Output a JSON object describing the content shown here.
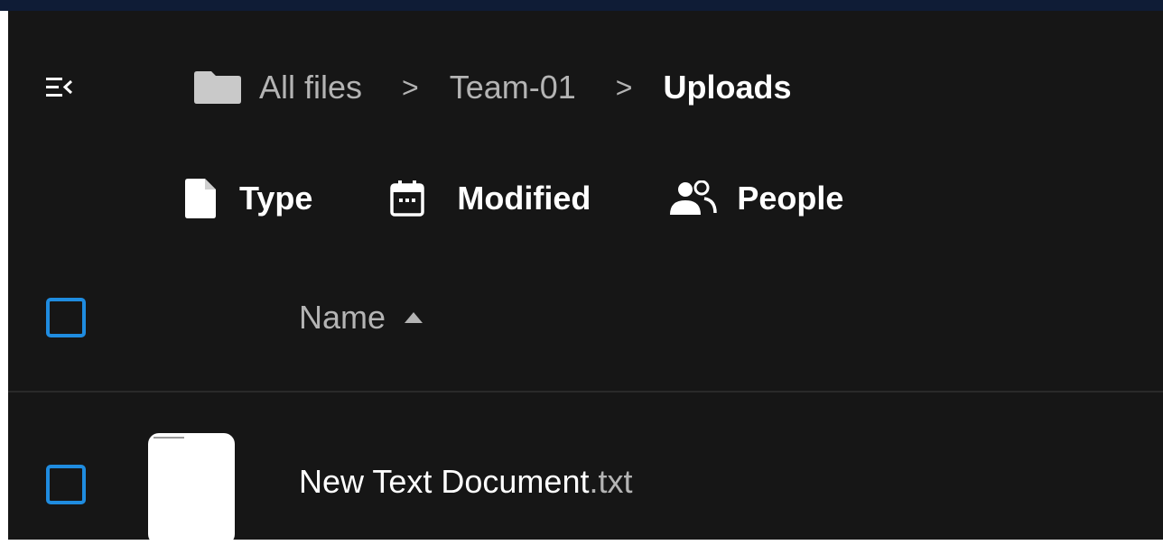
{
  "breadcrumb": {
    "root": "All files",
    "items": [
      "Team-01"
    ],
    "current": "Uploads",
    "separator": ">"
  },
  "filters": {
    "type": "Type",
    "modified": "Modified",
    "people": "People"
  },
  "table": {
    "columns": [
      {
        "label": "Name",
        "sort": "ascending"
      }
    ],
    "rows": [
      {
        "name": "New Text Document",
        "extension": ".txt",
        "selected": false
      }
    ]
  },
  "icons": {
    "nav_toggle": "collapse-navigation-icon",
    "folder": "folder-icon",
    "type": "document-icon",
    "modified": "calendar-icon",
    "people": "people-icon",
    "sort": "sort-ascending-icon"
  },
  "colors": {
    "background": "#161616",
    "accent": "#1f8ce0",
    "topbar": "#0f1c36",
    "text_primary": "#ffffff",
    "text_secondary": "#b4b4b4"
  }
}
